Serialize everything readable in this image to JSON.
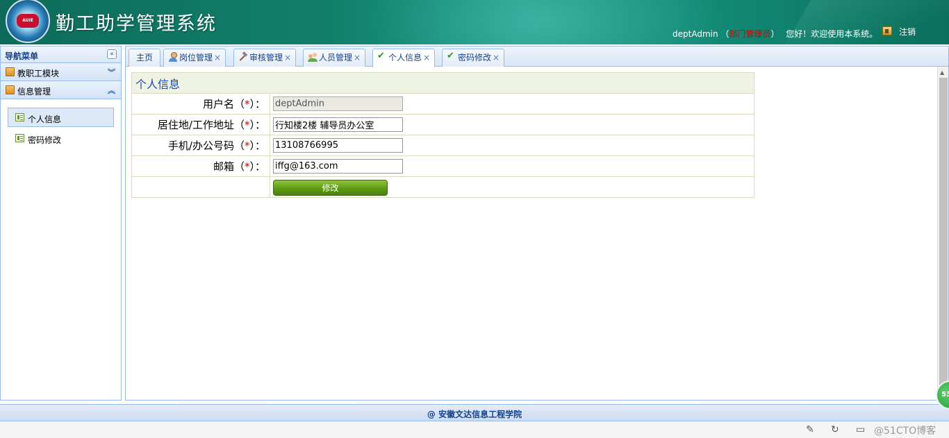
{
  "header": {
    "logo_text": "AUIE",
    "title": "勤工助学管理系统",
    "user_name": "deptAdmin",
    "role_open": "（",
    "role": "部门管理员",
    "role_close": "）",
    "greeting": "您好！欢迎使用本系统。",
    "logout_label": "注销"
  },
  "nav": {
    "title": "导航菜单",
    "collapse_glyph": "«",
    "sections": [
      {
        "label": "教职工模块",
        "chevron": "︾"
      },
      {
        "label": "信息管理",
        "chevron": "︽"
      }
    ],
    "items": [
      {
        "label": "个人信息",
        "active": true
      },
      {
        "label": "密码修改",
        "active": false
      }
    ]
  },
  "tabs": [
    {
      "label": "主页",
      "icon": "",
      "closable": false
    },
    {
      "label": "岗位管理",
      "icon": "user-icon",
      "closable": true
    },
    {
      "label": "审核管理",
      "icon": "hammer-icon",
      "closable": true
    },
    {
      "label": "人员管理",
      "icon": "people-icon",
      "closable": true
    },
    {
      "label": "个人信息",
      "icon": "check-icon",
      "closable": true,
      "active": true
    },
    {
      "label": "密码修改",
      "icon": "check-icon",
      "closable": true
    }
  ],
  "tab_close_glyph": "×",
  "form": {
    "title": "个人信息",
    "required_open": "（",
    "required_mark": "*",
    "required_close": "）：",
    "fields": [
      {
        "label": "用户名",
        "value": "deptAdmin",
        "readonly": true
      },
      {
        "label": "居住地/工作地址",
        "value": "行知楼2楼 辅导员办公室",
        "readonly": false
      },
      {
        "label": "手机/办公号码",
        "value": "13108766995",
        "readonly": false
      },
      {
        "label": "邮箱",
        "value": "iffg@163.com",
        "readonly": false
      }
    ],
    "submit_label": "修改"
  },
  "footer": {
    "text": "@ 安徽文达信息工程学院"
  },
  "overlay": {
    "watermark": "@51CTO博客",
    "badge": "53"
  },
  "colors": {
    "header_bg": "#11806b",
    "accent_blue": "#15428b",
    "required_red": "#d00000",
    "button_green": "#5e9a15"
  }
}
